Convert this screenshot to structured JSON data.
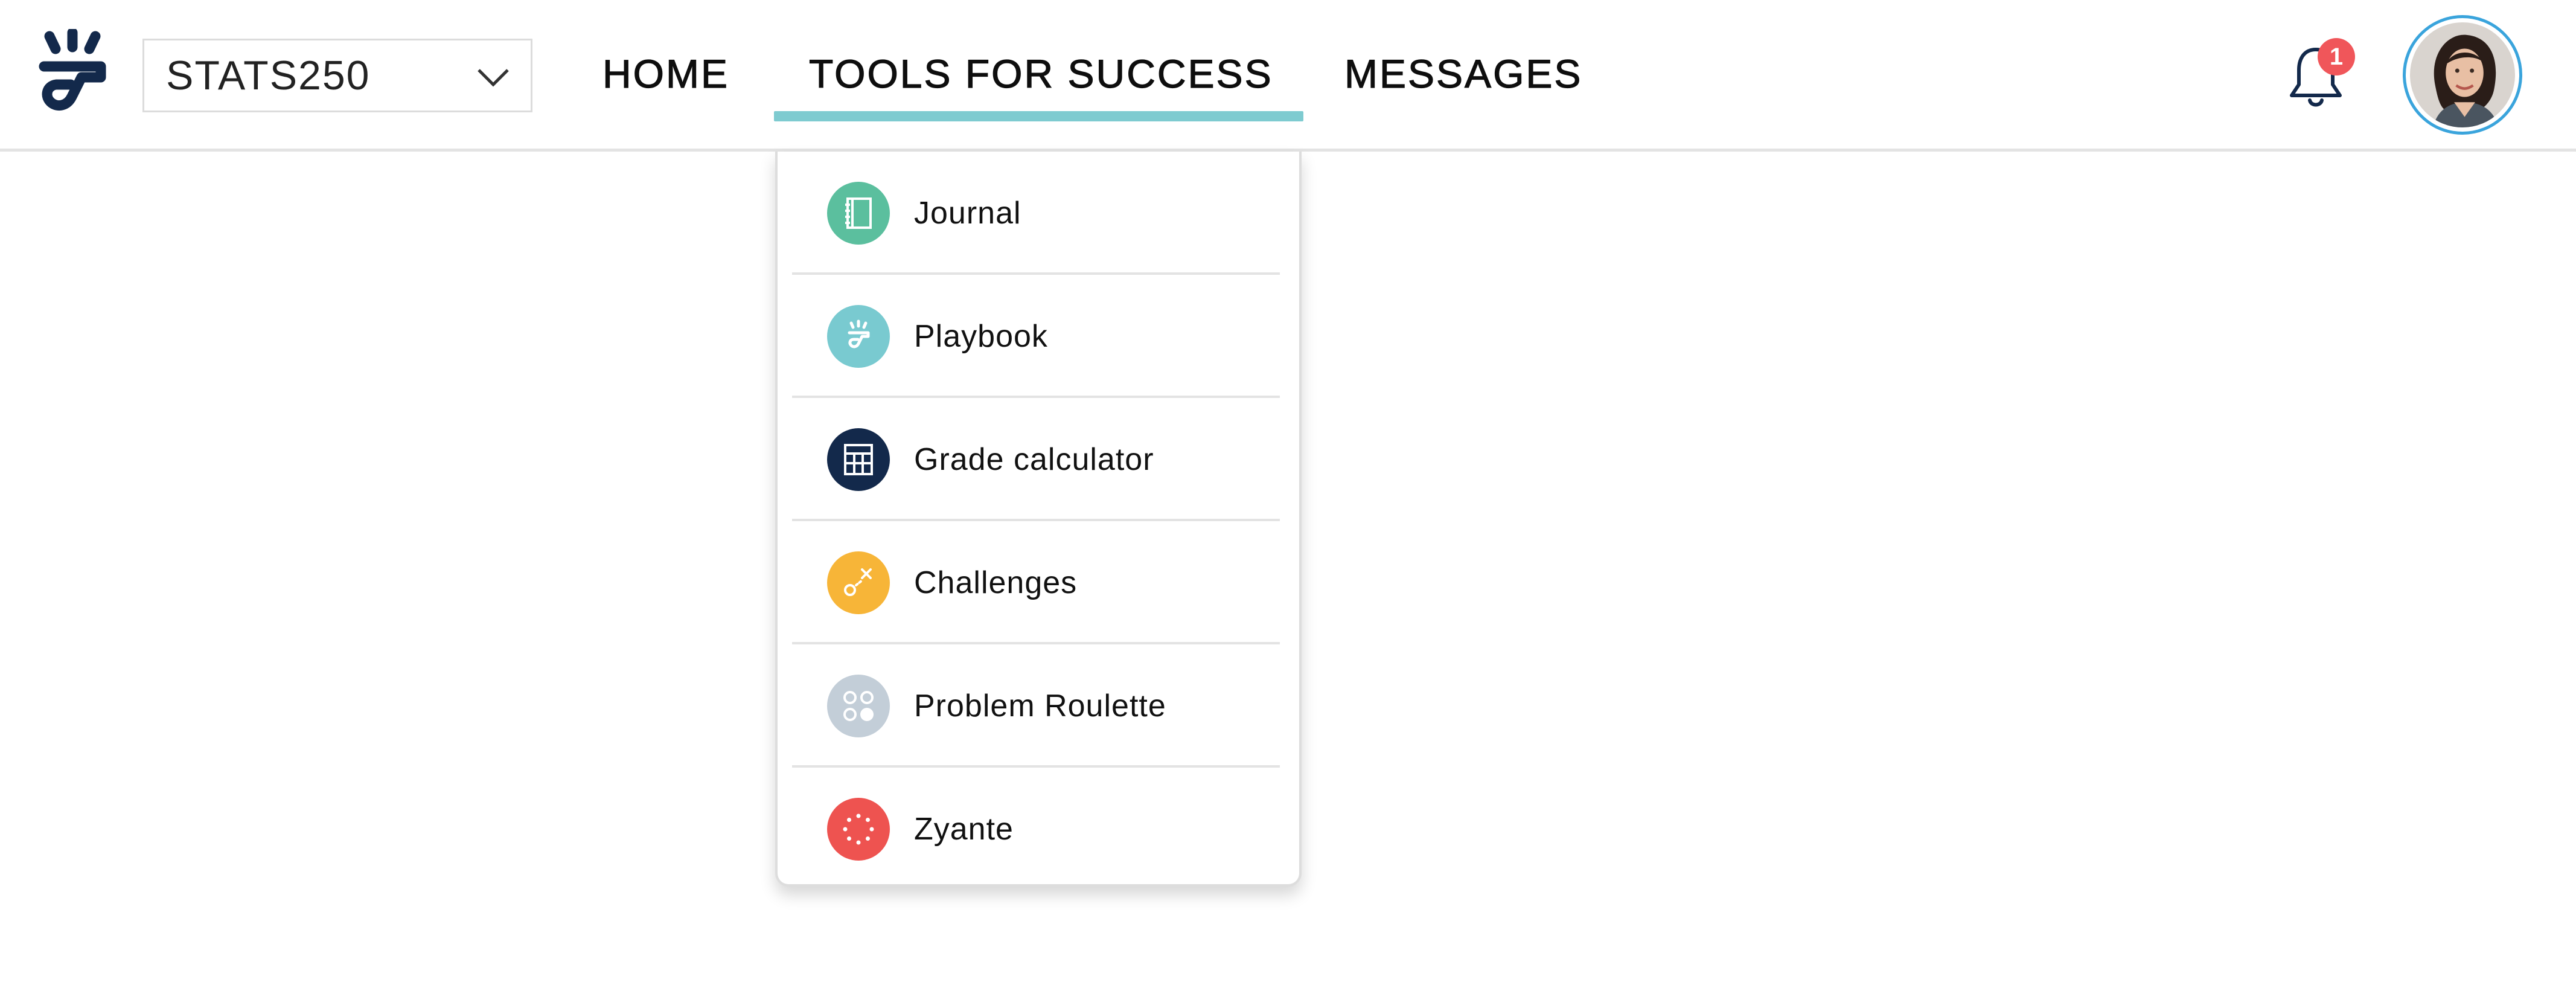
{
  "header": {
    "course_select": {
      "value": "STATS250"
    },
    "nav": {
      "home": "HOME",
      "tools": "TOOLS FOR SUCCESS",
      "messages": "MESSAGES"
    },
    "active_tab": "tools",
    "notification_count": "1"
  },
  "tools_menu": {
    "items": [
      {
        "label": "Journal",
        "icon": "journal-icon",
        "color": "#5bbf9e"
      },
      {
        "label": "Playbook",
        "icon": "playbook-icon",
        "color": "#79cad0"
      },
      {
        "label": "Grade calculator",
        "icon": "calculator-icon",
        "color": "#13294b"
      },
      {
        "label": "Challenges",
        "icon": "challenges-icon",
        "color": "#f7b538"
      },
      {
        "label": "Problem Roulette",
        "icon": "roulette-icon",
        "color": "#c3ced8"
      },
      {
        "label": "Zyante",
        "icon": "zyante-icon",
        "color": "#ee5350"
      }
    ]
  },
  "colors": {
    "brand_navy": "#13294b",
    "active_underline": "#7ecbd0",
    "badge": "#f0565a",
    "avatar_ring": "#3aa4dc"
  }
}
